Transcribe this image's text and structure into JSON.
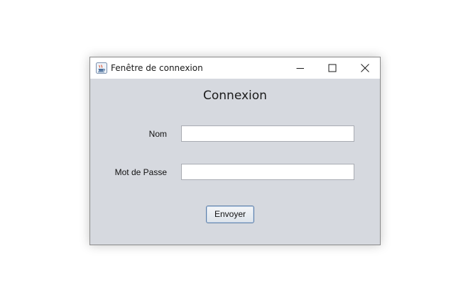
{
  "window": {
    "title": "Fenêtre de connexion",
    "app_icon": "java-cup-icon",
    "controls": [
      "minimize-icon",
      "maximize-icon",
      "close-icon"
    ]
  },
  "form": {
    "heading": "Connexion",
    "name_label": "Nom",
    "name_value": "",
    "password_label": "Mot de Passe",
    "password_value": "",
    "submit_label": "Envoyer"
  },
  "colors": {
    "content_background": "#d6d9df",
    "titlebar_background": "#ffffff",
    "button_border": "#5d7fa8"
  }
}
